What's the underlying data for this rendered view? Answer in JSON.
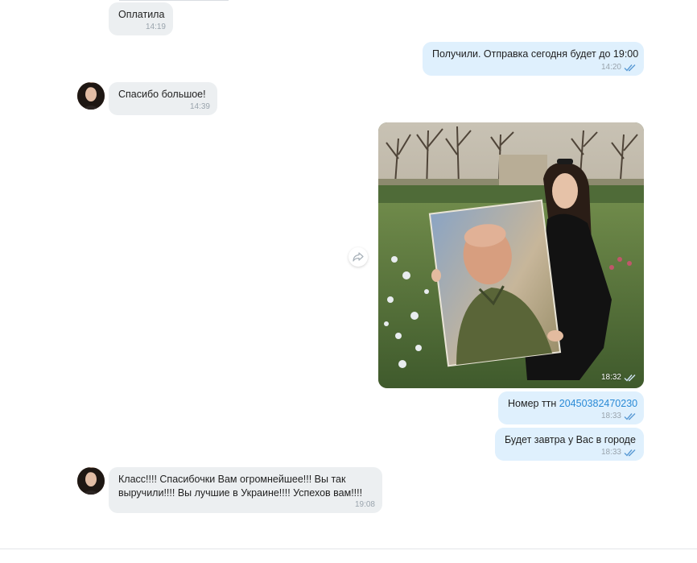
{
  "messages": [
    {
      "text": "Оплатила",
      "time": "14:19"
    },
    {
      "text": "Получили. Отправка сегодня будет до 19:00",
      "time": "14:20"
    },
    {
      "text": "Спасибо большое!",
      "time": "14:39"
    },
    {
      "type": "photo",
      "time": "18:32"
    },
    {
      "text_prefix": "Номер ттн ",
      "link": "20450382470230",
      "time": "18:33"
    },
    {
      "text": "Будет завтра у Вас в городе",
      "time": "18:33"
    },
    {
      "lines": [
        "Класс!!!! Спасибочки Вам огромнейшее!!! Вы так",
        "выручили!!!! Вы лучшие в Украине!!!! Успехов вам!!!!"
      ],
      "time": "19:08"
    }
  ],
  "colors": {
    "incoming_bubble": "#eceff1",
    "outgoing_bubble": "#dff0fd",
    "read_checks": "#5b9bd5",
    "link": "#2a8ad6"
  },
  "icons": [
    "double-check-icon",
    "share-icon",
    "avatar"
  ]
}
